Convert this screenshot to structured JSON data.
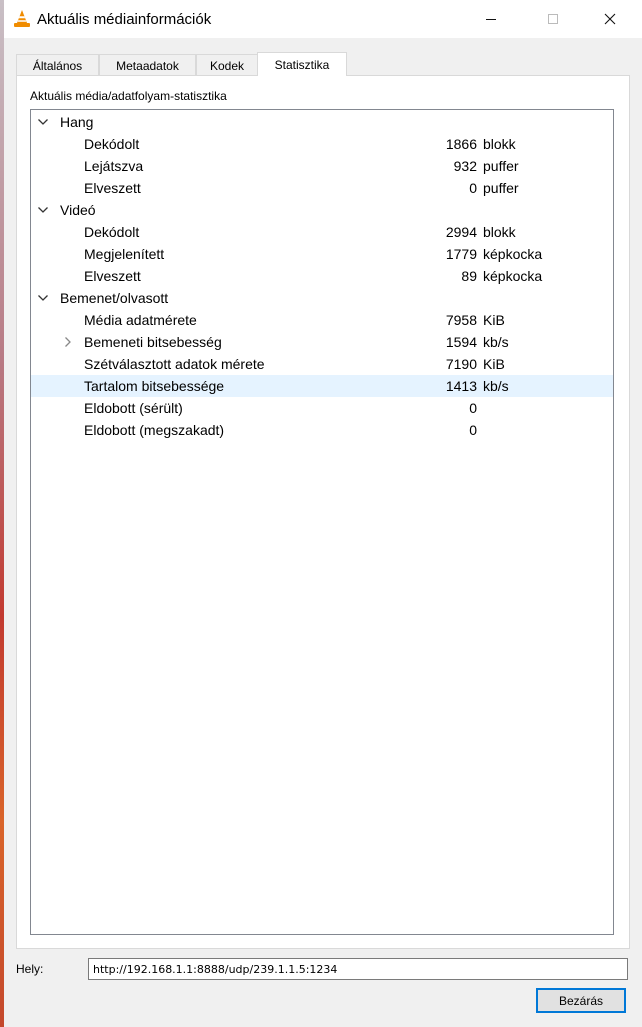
{
  "window": {
    "title": "Aktuális médiainformációk",
    "app_icon": "vlc-cone-icon",
    "controls": {
      "minimize": "minimize-icon",
      "maximize": "maximize-icon",
      "close": "close-icon"
    }
  },
  "tabs": [
    {
      "label": "Általános",
      "active": false
    },
    {
      "label": "Metaadatok",
      "active": false
    },
    {
      "label": "Kodek",
      "active": false
    },
    {
      "label": "Statisztika",
      "active": true
    }
  ],
  "stats": {
    "group_title": "Aktuális média/adatfolyam-statisztika",
    "sections": [
      {
        "label": "Hang",
        "expanded": true,
        "items": [
          {
            "label": "Dekódolt",
            "value": "1866",
            "unit": "blokk"
          },
          {
            "label": "Lejátszva",
            "value": "932",
            "unit": "puffer"
          },
          {
            "label": "Elveszett",
            "value": "0",
            "unit": "puffer"
          }
        ]
      },
      {
        "label": "Videó",
        "expanded": true,
        "items": [
          {
            "label": "Dekódolt",
            "value": "2994",
            "unit": "blokk"
          },
          {
            "label": "Megjelenített",
            "value": "1779",
            "unit": "képkocka"
          },
          {
            "label": "Elveszett",
            "value": "89",
            "unit": "képkocka"
          }
        ]
      },
      {
        "label": "Bemenet/olvasott",
        "expanded": true,
        "items": [
          {
            "label": "Média adatmérete",
            "value": "7958",
            "unit": "KiB"
          },
          {
            "label": "Bemeneti bitsebesség",
            "value": "1594",
            "unit": "kb/s",
            "expandable": true
          },
          {
            "label": "Szétválasztott adatok mérete",
            "value": "7190",
            "unit": "KiB"
          },
          {
            "label": "Tartalom bitsebessége",
            "value": "1413",
            "unit": "kb/s",
            "selected": true
          },
          {
            "label": "Eldobott (sérült)",
            "value": "0",
            "unit": ""
          },
          {
            "label": "Eldobott (megszakadt)",
            "value": "0",
            "unit": ""
          }
        ]
      }
    ]
  },
  "footer": {
    "location_label": "Hely:",
    "location_value": "http://192.168.1.1:8888/udp/239.1.1.5:1234",
    "close_button": "Bezárás"
  },
  "colors": {
    "selection": "#e5f3ff",
    "accent": "#0078d7",
    "vlc_orange": "#f08c00"
  }
}
